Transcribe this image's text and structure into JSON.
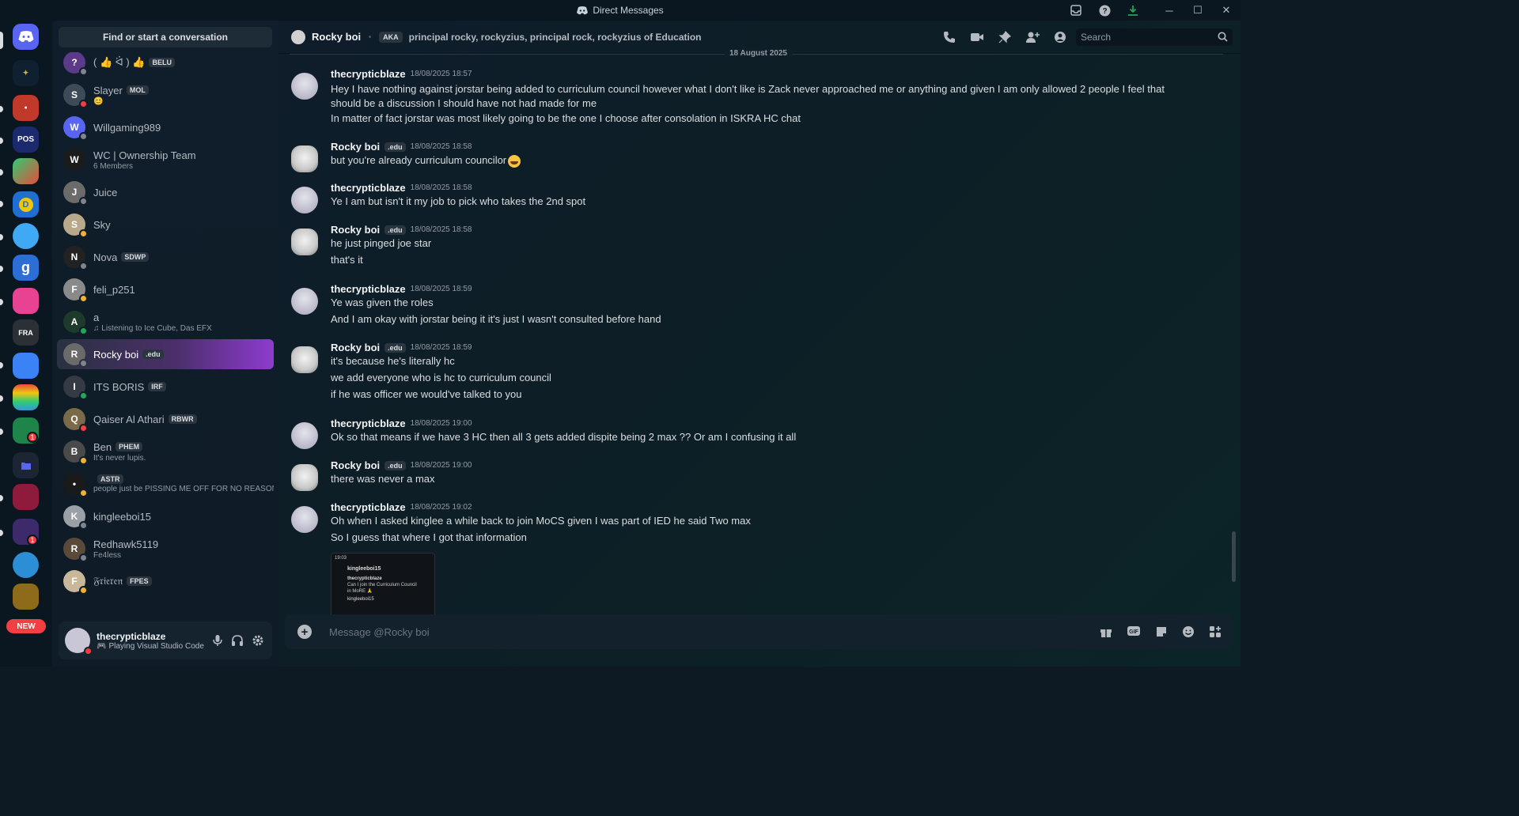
{
  "window": {
    "title": "Direct Messages"
  },
  "rail": {
    "new_label": "NEW",
    "pos_label": "POS",
    "badges": [
      "1",
      "1"
    ]
  },
  "sidebar": {
    "find_placeholder": "Find or start a conversation",
    "dms": [
      {
        "name": "( 👍 ᐛ ) 👍",
        "tag": "BELU",
        "sub": "",
        "status": "offline",
        "initial": "?"
      },
      {
        "name": "Slayer",
        "tag": "MOL",
        "sub": "😊",
        "status": "dnd",
        "initial": "S"
      },
      {
        "name": "Willgaming989",
        "tag": "",
        "sub": "",
        "status": "offline",
        "initial": "W"
      },
      {
        "name": "WC | Ownership Team",
        "tag": "",
        "sub": "6 Members",
        "status": "",
        "initial": "W"
      },
      {
        "name": "Juice",
        "tag": "",
        "sub": "",
        "status": "offline",
        "initial": "J"
      },
      {
        "name": "Sky",
        "tag": "",
        "sub": "",
        "status": "idle",
        "initial": "S"
      },
      {
        "name": "Nova",
        "tag": "SDWP",
        "sub": "",
        "status": "offline",
        "initial": "N"
      },
      {
        "name": "feli_p251",
        "tag": "",
        "sub": "",
        "status": "idle",
        "initial": "F"
      },
      {
        "name": "a",
        "tag": "",
        "sub": "♫ Listening to Ice Cube, Das EFX",
        "status": "online",
        "initial": "A"
      },
      {
        "name": "Rocky boi",
        "tag": ".edu",
        "sub": "",
        "status": "offline",
        "initial": "R",
        "active": true
      },
      {
        "name": "ITS BORIS",
        "tag": "IRF",
        "sub": "",
        "status": "online",
        "initial": "I"
      },
      {
        "name": "Qaiser Al Athari",
        "tag": "RBWR",
        "sub": "",
        "status": "dnd",
        "initial": "Q"
      },
      {
        "name": "Ben",
        "tag": "PHEM",
        "sub": "It's never lupis.",
        "status": "idle",
        "initial": "B"
      },
      {
        "name": "",
        "tag": "ASTR",
        "sub": "people just be PISSING ME OFF FOR NO REASON",
        "status": "idle",
        "initial": "•"
      },
      {
        "name": "kingleeboi15",
        "tag": "",
        "sub": "",
        "status": "offline",
        "initial": "K"
      },
      {
        "name": "Redhawk5119",
        "tag": "",
        "sub": "Fe4less",
        "status": "offline",
        "initial": "R"
      },
      {
        "name": "𝔉𝔯𝔦𝔢𝔯𝔢𝔫",
        "tag": "FPES",
        "sub": "",
        "status": "idle",
        "initial": "F"
      }
    ]
  },
  "user_panel": {
    "username": "thecrypticblaze",
    "activity": "Playing Visual Studio Code"
  },
  "header": {
    "name": "Rocky boi",
    "aka_label": "AKA",
    "aka_names": "principal rocky, rockyzius, principal rock, rockyzius of Education",
    "search_placeholder": "Search"
  },
  "date_separator": "18 August 2025",
  "messages": [
    {
      "author": "thecrypticblaze",
      "avatar": "blaze",
      "tag": "",
      "time": "18/08/2025 18:57",
      "lines": [
        "Hey I have nothing against jorstar being added to curriculum council however what I don't like is Zack never approached me or anything and given I am only allowed 2 people I feel that should be a discussion I should have not had made for me",
        "In matter of fact jorstar was most likely going to be the one I choose after consolation in ISKRA HC chat"
      ]
    },
    {
      "author": "Rocky boi",
      "avatar": "rocky",
      "tag": ".edu",
      "time": "18/08/2025 18:58",
      "lines": [
        "but you're already curriculum councilor"
      ]
    },
    {
      "author": "thecrypticblaze",
      "avatar": "blaze",
      "tag": "",
      "time": "18/08/2025 18:58",
      "lines": [
        "Ye I am but isn't it my job to pick who takes the 2nd spot"
      ]
    },
    {
      "author": "Rocky boi",
      "avatar": "rocky",
      "tag": ".edu",
      "time": "18/08/2025 18:58",
      "lines": [
        "he just pinged joe star",
        "that's it"
      ]
    },
    {
      "author": "thecrypticblaze",
      "avatar": "blaze",
      "tag": "",
      "time": "18/08/2025 18:59",
      "lines": [
        "Ye was given the roles",
        "And I am okay with jorstar being it it's just I wasn't consulted before hand"
      ]
    },
    {
      "author": "Rocky boi",
      "avatar": "rocky",
      "tag": ".edu",
      "time": "18/08/2025 18:59",
      "lines": [
        "it's because he's literally hc",
        "we add everyone who is hc to curriculum council",
        "if he was officer we would've talked to you"
      ]
    },
    {
      "author": "thecrypticblaze",
      "avatar": "blaze",
      "tag": "",
      "time": "18/08/2025 19:00",
      "lines": [
        "Ok so that means if we have 3 HC then all 3 gets added dispite being 2 max ?? Or am I confusing it all"
      ]
    },
    {
      "author": "Rocky boi",
      "avatar": "rocky",
      "tag": ".edu",
      "time": "18/08/2025 19:00",
      "lines": [
        "there was never a max"
      ]
    },
    {
      "author": "thecrypticblaze",
      "avatar": "blaze",
      "tag": "",
      "time": "18/08/2025 19:02",
      "lines": [
        "Oh when I asked kinglee a while back to join MoCS given I was part of IED he said Two max",
        "So I guess that where I got that information"
      ]
    }
  ],
  "attachment": {
    "time": "19:03",
    "name": "kingleeboi15",
    "author": "thecrypticblaze",
    "text": "Can I join the Curriculum Council in MoRE 🙏",
    "author2": "kingleeboi15"
  },
  "composer": {
    "placeholder": "Message @Rocky boi"
  }
}
